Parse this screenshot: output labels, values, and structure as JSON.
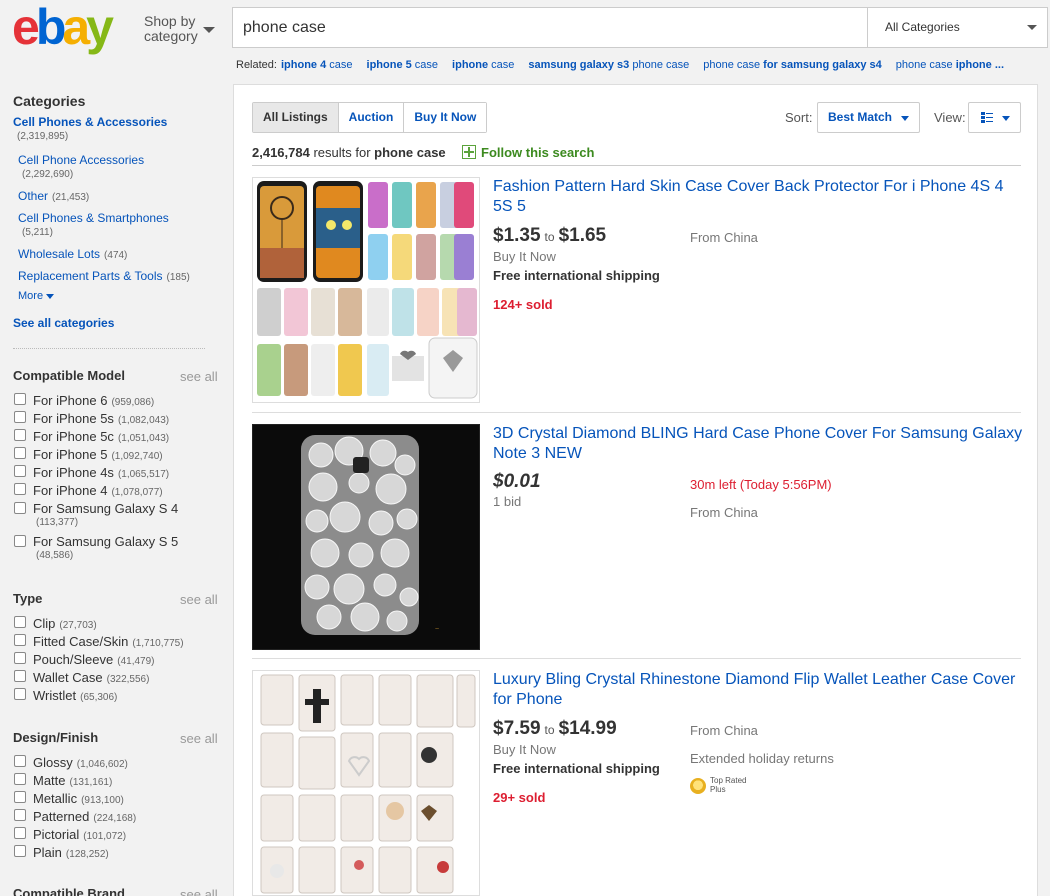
{
  "header": {
    "shop_by_line1": "Shop by",
    "shop_by_line2": "category",
    "search_value": "phone case",
    "category_select": "All Categories"
  },
  "related": {
    "label": "Related:",
    "links": [
      {
        "bold": "iphone 4",
        "rest": " case"
      },
      {
        "bold": "iphone 5",
        "rest": " case"
      },
      {
        "bold": "iphone",
        "rest": " case"
      },
      {
        "bold": "samsung galaxy s3",
        "rest": " phone case"
      },
      {
        "pre": "phone case ",
        "bold": "for samsung galaxy s4"
      },
      {
        "pre": "phone case ",
        "bold": "iphone ..."
      }
    ]
  },
  "sidebar": {
    "categories_heading": "Categories",
    "top_category": {
      "label": "Cell Phones & Accessories",
      "count": "(2,319,895)"
    },
    "sub_categories": [
      {
        "label": "Cell Phone Accessories",
        "count": "(2,292,690)"
      },
      {
        "label": "Other",
        "count": "(21,453)"
      },
      {
        "label": "Cell Phones & Smartphones",
        "count": "(5,211)"
      },
      {
        "label": "Wholesale Lots",
        "count": "(474)"
      },
      {
        "label": "Replacement Parts & Tools",
        "count": "(185)"
      }
    ],
    "more_label": "More",
    "see_all_categories": "See all categories",
    "see_all": "see all",
    "compatible_model": {
      "heading": "Compatible Model",
      "items": [
        {
          "label": "For iPhone 6",
          "count": "(959,086)"
        },
        {
          "label": "For iPhone 5s",
          "count": "(1,082,043)"
        },
        {
          "label": "For iPhone 5c",
          "count": "(1,051,043)"
        },
        {
          "label": "For iPhone 5",
          "count": "(1,092,740)"
        },
        {
          "label": "For iPhone 4s",
          "count": "(1,065,517)"
        },
        {
          "label": "For iPhone 4",
          "count": "(1,078,077)"
        },
        {
          "label": "For Samsung Galaxy S 4",
          "count": "(113,377)"
        },
        {
          "label": "For Samsung Galaxy S 5",
          "count": "(48,586)"
        }
      ]
    },
    "type": {
      "heading": "Type",
      "items": [
        {
          "label": "Clip",
          "count": "(27,703)"
        },
        {
          "label": "Fitted Case/Skin",
          "count": "(1,710,775)"
        },
        {
          "label": "Pouch/Sleeve",
          "count": "(41,479)"
        },
        {
          "label": "Wallet Case",
          "count": "(322,556)"
        },
        {
          "label": "Wristlet",
          "count": "(65,306)"
        }
      ]
    },
    "design_finish": {
      "heading": "Design/Finish",
      "items": [
        {
          "label": "Glossy",
          "count": "(1,046,602)"
        },
        {
          "label": "Matte",
          "count": "(131,161)"
        },
        {
          "label": "Metallic",
          "count": "(913,100)"
        },
        {
          "label": "Patterned",
          "count": "(224,168)"
        },
        {
          "label": "Pictorial",
          "count": "(101,072)"
        },
        {
          "label": "Plain",
          "count": "(128,252)"
        }
      ]
    },
    "compatible_brand": {
      "heading": "Compatible Brand"
    }
  },
  "toolbar": {
    "tabs": [
      "All Listings",
      "Auction",
      "Buy It Now"
    ],
    "sort_label": "Sort:",
    "sort_value": "Best Match",
    "view_label": "View:"
  },
  "results": {
    "count": "2,416,784",
    "results_for": " results for ",
    "query": "phone case",
    "follow_label": "Follow this search"
  },
  "items": [
    {
      "title": "Fashion Pattern Hard Skin Case Cover Back Protector For i Phone 4S 4 5S 5",
      "price_low": "$1.35",
      "price_to": "to",
      "price_high": "$1.65",
      "format": "Buy It Now",
      "shipping": "Free international shipping",
      "sold": "124+ sold",
      "location": "From China"
    },
    {
      "title": "3D Crystal Diamond BLING Hard Case Phone Cover For Samsung Galaxy Note 3 NEW",
      "price": "$0.01",
      "bids": "1 bid",
      "time_left": "30m left (Today 5:56PM)",
      "location": "From China"
    },
    {
      "title": "Luxury Bling Crystal Rhinestone Diamond Flip Wallet Leather Case Cover for Phone",
      "price_low": "$7.59",
      "price_to": "to",
      "price_high": "$14.99",
      "format": "Buy It Now",
      "shipping": "Free international shipping",
      "sold": "29+ sold",
      "location": "From China",
      "returns": "Extended holiday returns",
      "badge_line1": "Top Rated",
      "badge_line2": "Plus"
    }
  ],
  "colors": {
    "link": "#0654ba",
    "sold_red": "#dd1e31",
    "follow_green": "#3c8a1f",
    "logo_e": "#e53238",
    "logo_b": "#0064d2",
    "logo_a": "#f5af02",
    "logo_y": "#86b817"
  }
}
